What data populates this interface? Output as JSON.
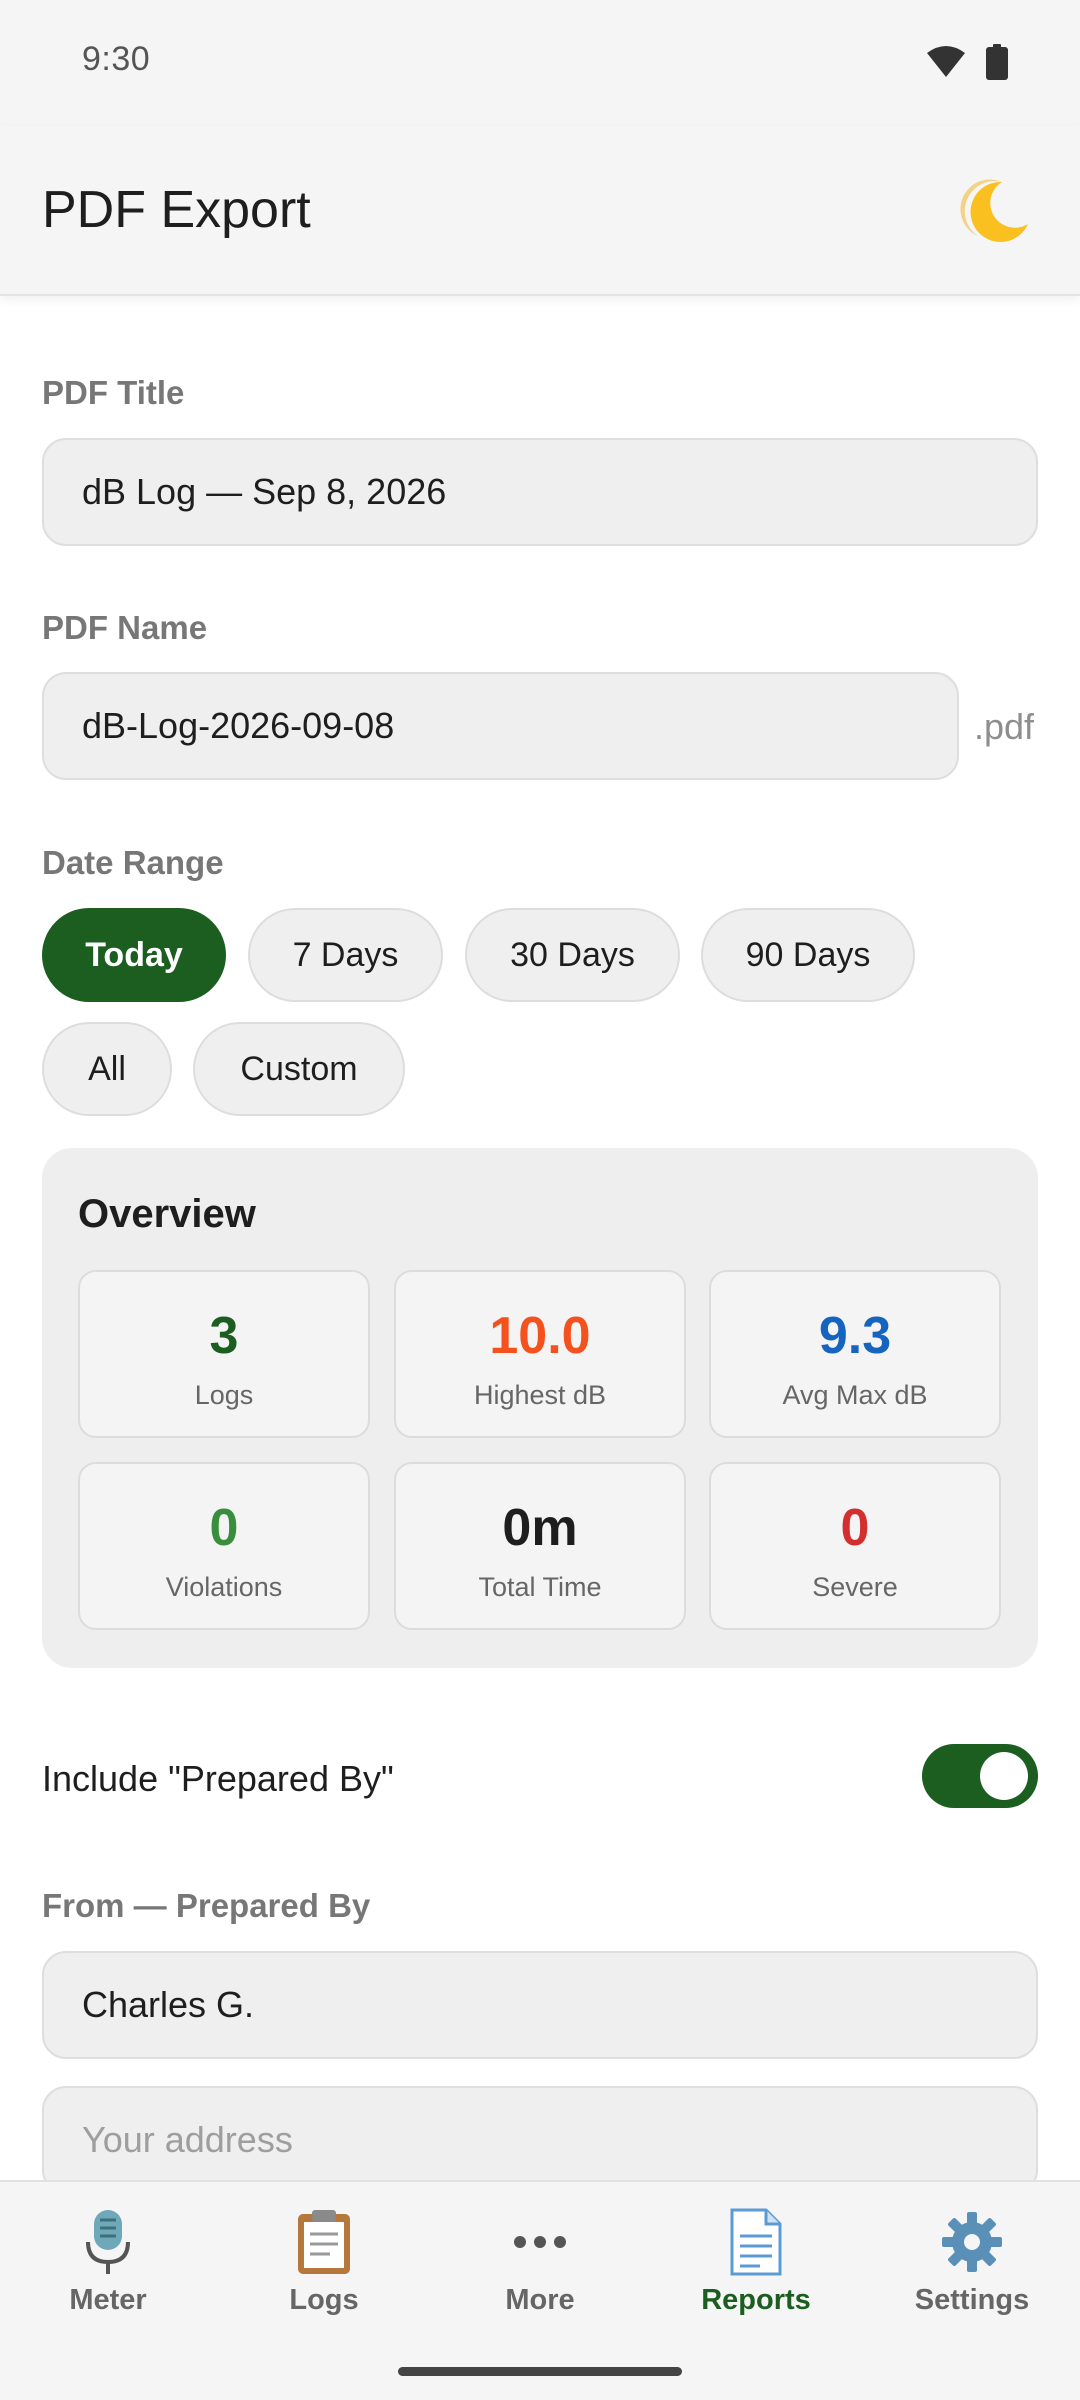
{
  "status_bar": {
    "time": "9:30"
  },
  "app_bar": {
    "title": "PDF Export"
  },
  "pdf_title": {
    "label": "PDF Title",
    "value": "dB Log — Sep 8, 2026"
  },
  "pdf_name": {
    "label": "PDF Name",
    "value": "dB-Log-2026-09-08",
    "suffix": ".pdf"
  },
  "date_range": {
    "label": "Date Range",
    "selected": "Today",
    "options": [
      "Today",
      "7 Days",
      "30 Days",
      "90 Days",
      "All",
      "Custom"
    ]
  },
  "overview": {
    "title": "Overview",
    "stats": [
      {
        "value": "3",
        "label": "Logs",
        "color": "#1b5e20"
      },
      {
        "value": "10.0",
        "label": "Highest dB",
        "color": "#f4511e"
      },
      {
        "value": "9.3",
        "label": "Avg Max dB",
        "color": "#1565c0"
      },
      {
        "value": "0",
        "label": "Violations",
        "color": "#388e3c"
      },
      {
        "value": "0m",
        "label": "Total Time",
        "color": "#1e1e1e"
      },
      {
        "value": "0",
        "label": "Severe",
        "color": "#d32f2f"
      }
    ]
  },
  "prepared_by_toggle": {
    "label": "Include \"Prepared By\"",
    "on": true
  },
  "prepared_by": {
    "label": "From — Prepared By",
    "name_value": "Charles G.",
    "address_placeholder": "Your address"
  },
  "bottom_nav": {
    "active": "Reports",
    "items": [
      {
        "label": "Meter",
        "icon": "microphone-icon"
      },
      {
        "label": "Logs",
        "icon": "clipboard-icon"
      },
      {
        "label": "More",
        "icon": "more-dots-icon"
      },
      {
        "label": "Reports",
        "icon": "document-icon"
      },
      {
        "label": "Settings",
        "icon": "gear-icon"
      }
    ]
  },
  "colors": {
    "accent": "#1b5e20",
    "background": "#f5f5f5"
  }
}
